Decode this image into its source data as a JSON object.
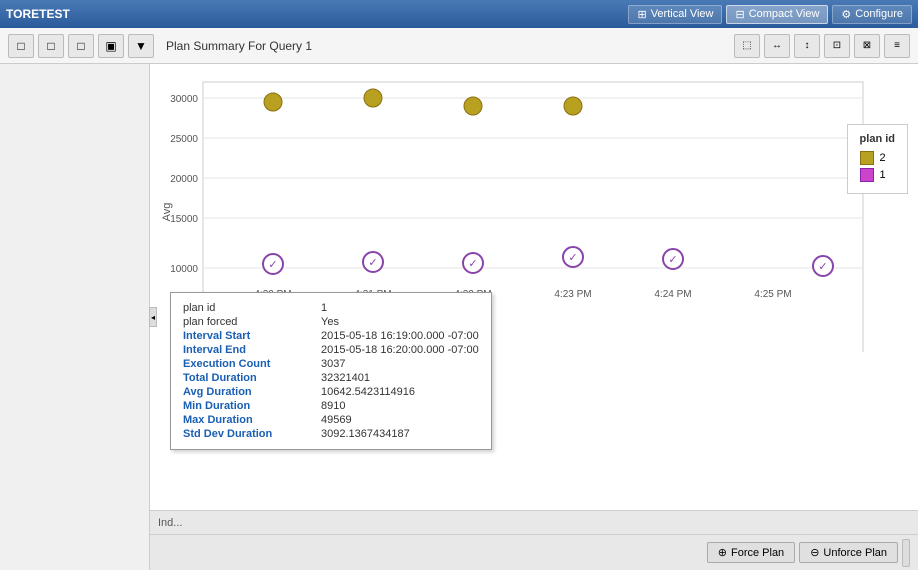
{
  "titleBar": {
    "appName": "TORETEST",
    "views": [
      {
        "id": "vertical",
        "label": "Vertical View",
        "icon": "⊞",
        "active": false
      },
      {
        "id": "compact",
        "label": "Compact View",
        "icon": "⊟",
        "active": true
      },
      {
        "id": "configure",
        "label": "Configure",
        "icon": "⚙",
        "active": false
      }
    ]
  },
  "toolbar": {
    "title": "Plan Summary For Query 1",
    "buttons": [
      "□",
      "□",
      "□",
      "▣",
      "▼"
    ]
  },
  "chart": {
    "title": "Plan Summary For Query 1",
    "yAxisLabel": "Avg",
    "yAxisValues": [
      "30000",
      "25000",
      "20000",
      "15000",
      "10000"
    ],
    "xAxisLabels": [
      "4:20 PM",
      "4:21 PM",
      "4:22 PM",
      "4:23 PM",
      "4:24 PM",
      "4:25 PM"
    ],
    "legend": {
      "title": "plan id",
      "items": [
        {
          "id": "2",
          "color": "#b8a020"
        },
        {
          "id": "1",
          "color": "#cc44cc"
        }
      ]
    }
  },
  "infoPanel": {
    "rows": [
      {
        "label": "plan id",
        "value": "1",
        "bold": false
      },
      {
        "label": "plan forced",
        "value": "Yes",
        "bold": false
      },
      {
        "label": "Interval Start",
        "value": "2015-05-18 16:19:00.000 -07:00",
        "bold": true
      },
      {
        "label": "Interval End",
        "value": "2015-05-18 16:20:00.000 -07:00",
        "bold": true
      },
      {
        "label": "Execution Count",
        "value": "3037",
        "bold": true
      },
      {
        "label": "Total Duration",
        "value": "32321401",
        "bold": true
      },
      {
        "label": "Avg Duration",
        "value": "10642.5423114916",
        "bold": true
      },
      {
        "label": "Min Duration",
        "value": "8910",
        "bold": true
      },
      {
        "label": "Max Duration",
        "value": "49569",
        "bold": true
      },
      {
        "label": "Std Dev Duration",
        "value": "3092.1367434187",
        "bold": true
      }
    ]
  },
  "bottomToolbar": {
    "forcePlanLabel": "Force Plan",
    "unforcePlanLabel": "Unforce Plan"
  },
  "indexArea": {
    "label": "Ind..."
  }
}
